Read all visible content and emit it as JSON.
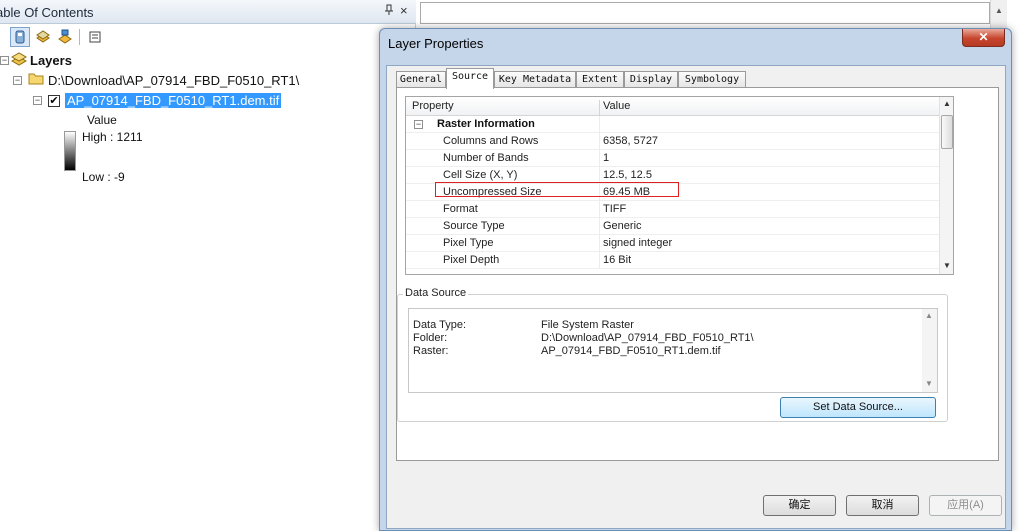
{
  "toc": {
    "title": "able Of Contents",
    "pin_glyph": " p",
    "close_glyph": "×",
    "tree": {
      "root_label": "Layers",
      "folder_label": "D:\\Download\\AP_07914_FBD_F0510_RT1\\",
      "layer_label": "AP_07914_FBD_F0510_RT1.dem.tif",
      "legend_title": "Value",
      "legend_high": "High : 1211",
      "legend_low": "Low : -9",
      "expander_glyph": "−",
      "check_glyph": "✔"
    }
  },
  "dialog": {
    "title": "Layer Properties",
    "close_glyph": "✕",
    "tabs": [
      "General",
      "Source",
      "Key Metadata",
      "Extent",
      "Display",
      "Symbology"
    ],
    "active_tab": "Source",
    "grid": {
      "col_property": "Property",
      "col_value": "Value",
      "category": "Raster Information",
      "rows": [
        {
          "k": "Columns and Rows",
          "v": "6358, 5727"
        },
        {
          "k": "Number of Bands",
          "v": "1"
        },
        {
          "k": "Cell Size (X, Y)",
          "v": "12.5, 12.5"
        },
        {
          "k": "Uncompressed Size",
          "v": "69.45 MB"
        },
        {
          "k": "Format",
          "v": "TIFF"
        },
        {
          "k": "Source Type",
          "v": "Generic"
        },
        {
          "k": "Pixel Type",
          "v": "signed integer"
        },
        {
          "k": "Pixel Depth",
          "v": "16 Bit"
        }
      ],
      "highlighted_row": "Cell Size (X, Y)"
    },
    "data_source": {
      "caption": "Data Source",
      "rows": [
        {
          "k": "Data Type:",
          "v": "File System Raster"
        },
        {
          "k": "Folder:",
          "v": "D:\\Download\\AP_07914_FBD_F0510_RT1\\"
        },
        {
          "k": "Raster:",
          "v": "AP_07914_FBD_F0510_RT1.dem.tif"
        }
      ],
      "set_button": "Set Data Source..."
    },
    "buttons": {
      "ok": "确定",
      "cancel": "取消",
      "apply": "应用(A)"
    }
  },
  "colors": {
    "selection": "#3399ff",
    "highlight_border": "#e02020",
    "dialog_frame": "#c5d6ea"
  }
}
